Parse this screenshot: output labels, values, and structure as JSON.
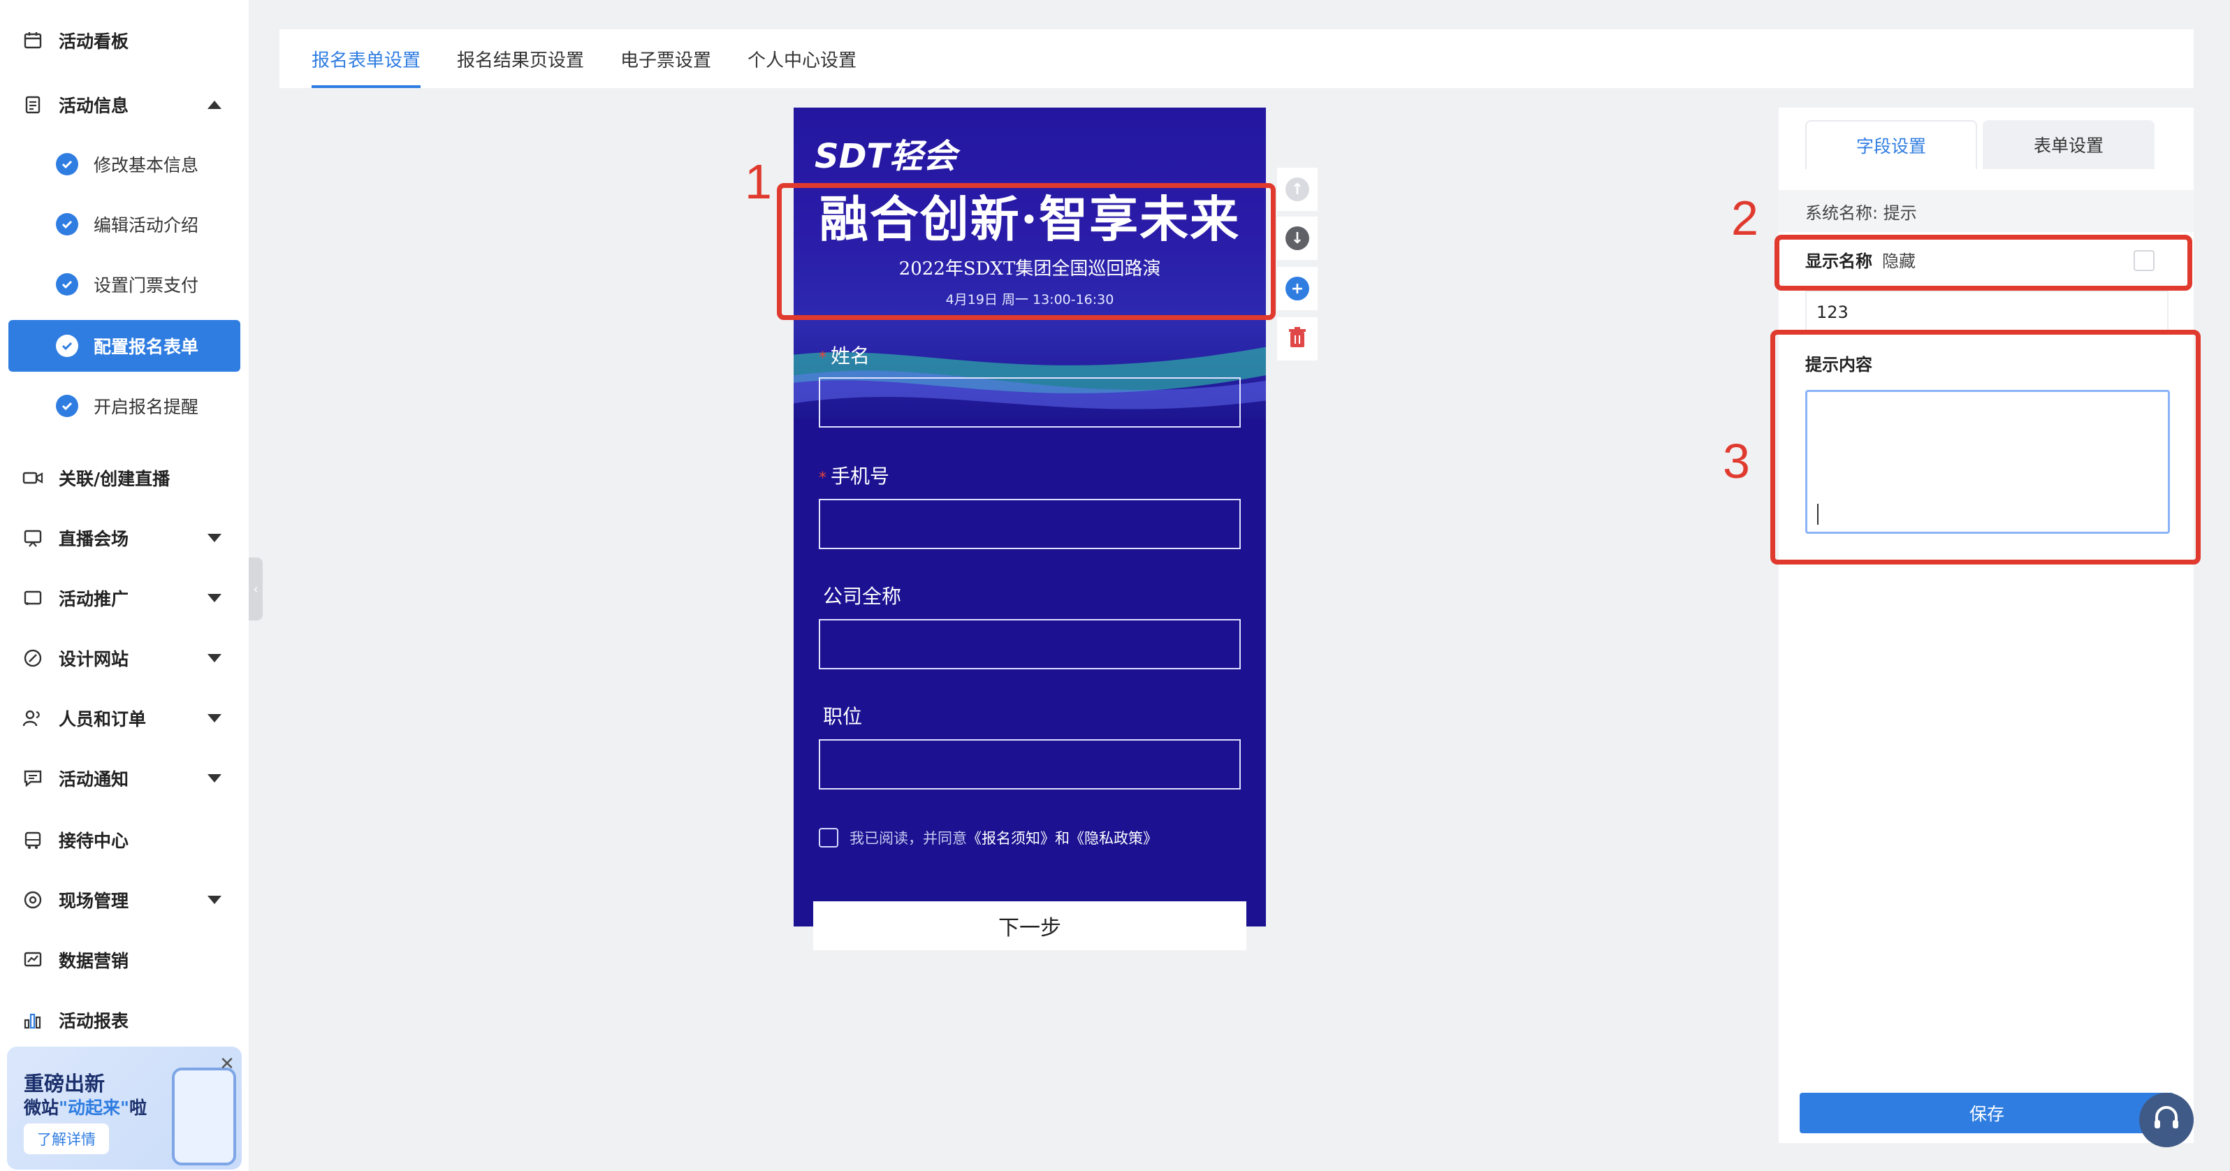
{
  "sidebar": {
    "items": [
      {
        "label": "活动看板",
        "icon": "calendar-icon"
      },
      {
        "label": "活动信息",
        "icon": "document-icon"
      },
      {
        "label": "关联/创建直播",
        "icon": "video-icon"
      },
      {
        "label": "直播会场",
        "icon": "presentation-icon"
      },
      {
        "label": "活动推广",
        "icon": "cast-icon"
      },
      {
        "label": "设计网站",
        "icon": "compass-icon"
      },
      {
        "label": "人员和订单",
        "icon": "users-icon"
      },
      {
        "label": "活动通知",
        "icon": "message-icon"
      },
      {
        "label": "接待中心",
        "icon": "bus-icon"
      },
      {
        "label": "现场管理",
        "icon": "target-icon"
      },
      {
        "label": "数据营销",
        "icon": "trend-icon"
      },
      {
        "label": "活动报表",
        "icon": "bar-chart-icon"
      }
    ],
    "sub_items": [
      {
        "label": "修改基本信息"
      },
      {
        "label": "编辑活动介绍"
      },
      {
        "label": "设置门票支付"
      },
      {
        "label": "配置报名表单"
      },
      {
        "label": "开启报名提醒"
      }
    ],
    "promo": {
      "title": "重磅出新",
      "line2_prefix": "微站",
      "line2_highlight": "\"动起来\"",
      "line2_suffix": "啦",
      "button": "了解详情",
      "close": "✕"
    }
  },
  "top_tabs": [
    "报名表单设置",
    "报名结果页设置",
    "电子票设置",
    "个人中心设置"
  ],
  "preview": {
    "logo": "SDT轻会",
    "headline": "融合创新·智享未来",
    "subline": "2022年SDXT集团全国巡回路演",
    "dateline": "4月19日 周一 13:00-16:30",
    "fields": [
      {
        "label": "姓名",
        "required": "*"
      },
      {
        "label": "手机号",
        "required": "*"
      },
      {
        "label": "公司全称",
        "required": ""
      },
      {
        "label": "职位",
        "required": ""
      }
    ],
    "agree_prefix": "我已阅读，并同意",
    "agree_links": "《报名须知》和《隐私政策》",
    "next_button": "下一步"
  },
  "right_panel": {
    "tabs": [
      "字段设置",
      "表单设置"
    ],
    "system_name": "系统名称: 提示",
    "display_name_label": "显示名称",
    "hide_label": "隐藏",
    "display_name_value": "123",
    "tip_label": "提示内容",
    "save_button": "保存"
  },
  "annotations": [
    "1",
    "2",
    "3"
  ],
  "colors": {
    "accent": "#2f7de1",
    "annotation": "#e03a2f",
    "banner": "#1b1191"
  }
}
